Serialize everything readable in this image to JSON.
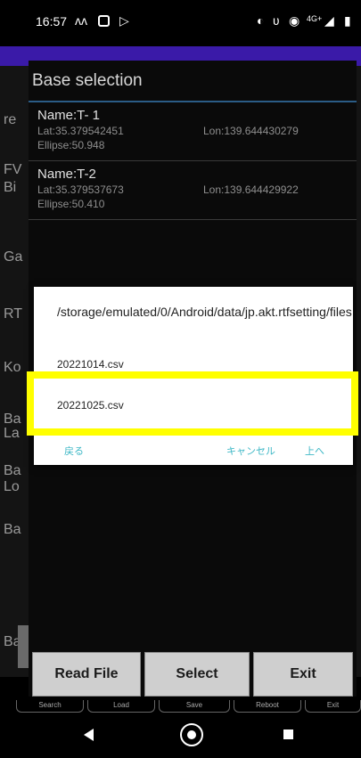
{
  "status_bar": {
    "time": "16:57",
    "network": "4G+"
  },
  "base_selection": {
    "title": "Base selection",
    "records": [
      {
        "name": "Name:T- 1",
        "lat": "Lat:35.379542451",
        "lon": "Lon:139.644430279",
        "ellipse": "Ellipse:50.948"
      },
      {
        "name": "Name:T-2",
        "lat": "Lat:35.379537673",
        "lon": "Lon:139.644429922",
        "ellipse": "Ellipse:50.410"
      }
    ],
    "buttons": {
      "read_file": "Read File",
      "select": "Select",
      "exit": "Exit"
    }
  },
  "background_letters": [
    "re",
    "FV",
    "Bi",
    "Ga",
    "RT",
    "Ko",
    "Ba",
    "La",
    "Ba",
    "Lo",
    "Ba",
    "Ba"
  ],
  "bottom_toolbar": [
    "Search",
    "Load",
    "Save",
    "Reboot",
    "Exit"
  ],
  "file_dialog": {
    "path": "/storage/emulated/0/Android/data/jp.akt.rtfsetting/files",
    "files": [
      "20221014.csv",
      "20221025.csv"
    ],
    "actions": {
      "back": "戻る",
      "cancel": "キャンセル",
      "up": "上へ"
    },
    "accent_color": "#3fb8c6"
  },
  "highlight_color": "#ffff00",
  "appbar_color": "#3a1aa8"
}
